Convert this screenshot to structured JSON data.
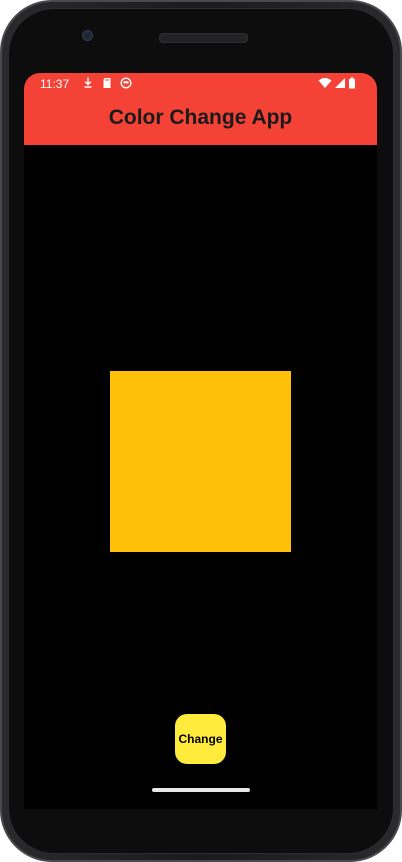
{
  "status_bar": {
    "time": "11:37",
    "left_icons": [
      "download-icon",
      "sd-card-icon",
      "face-icon"
    ],
    "right_icons": [
      "wifi-icon",
      "cell-signal-icon",
      "battery-icon"
    ]
  },
  "app_bar": {
    "title": "Color Change App",
    "color": "#F44336"
  },
  "color_box": {
    "color": "#FFC107"
  },
  "change_button": {
    "label": "Change",
    "color": "#FFEB3B"
  },
  "screen": {
    "background": "#000000"
  }
}
